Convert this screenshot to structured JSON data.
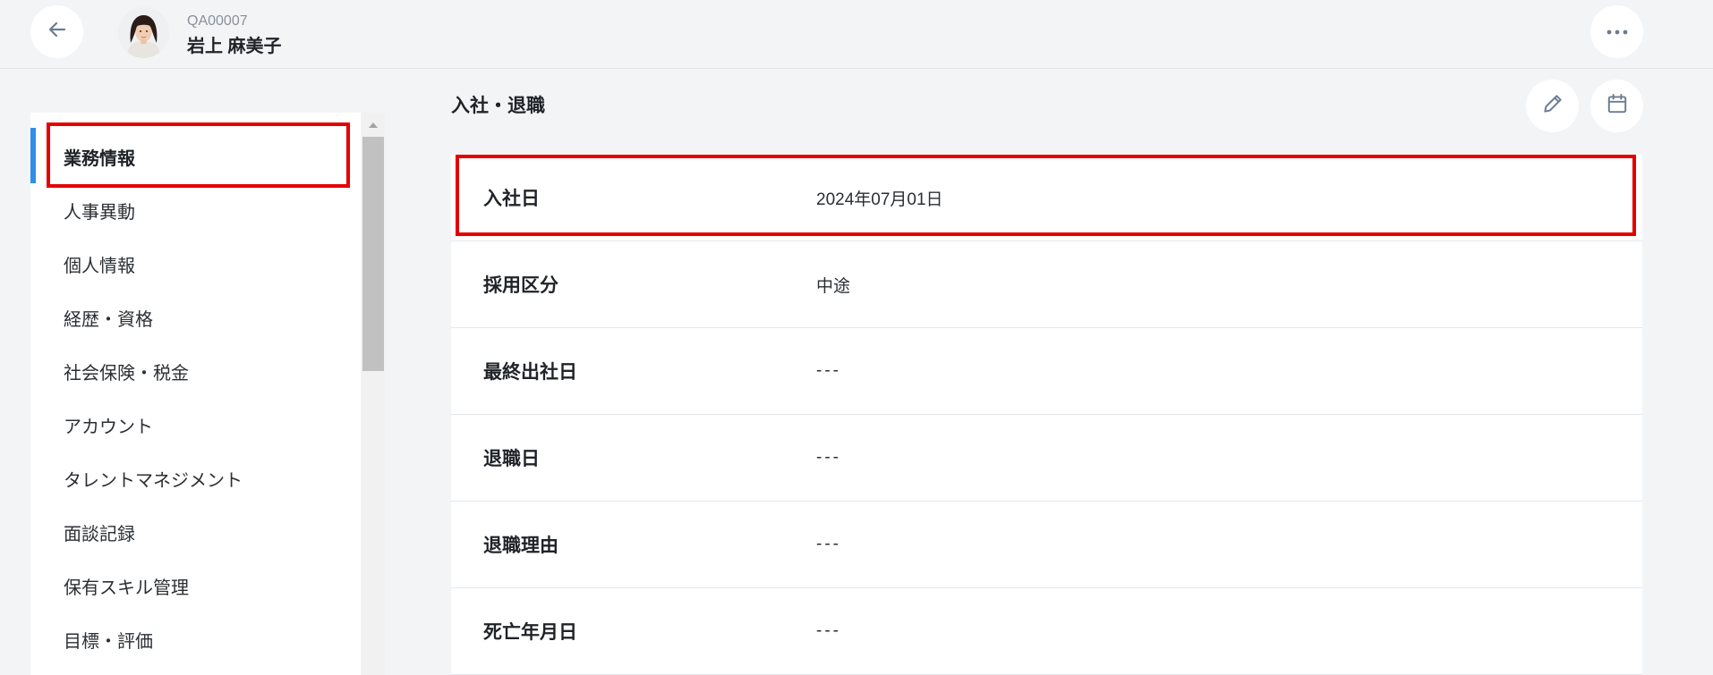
{
  "header": {
    "employee_id": "QA00007",
    "employee_name": "岩上 麻美子"
  },
  "sidebar": {
    "items": [
      {
        "label": "業務情報",
        "active": true
      },
      {
        "label": "人事異動"
      },
      {
        "label": "個人情報"
      },
      {
        "label": "経歴・資格"
      },
      {
        "label": "社会保険・税金"
      },
      {
        "label": "アカウント"
      },
      {
        "label": "タレントマネジメント"
      },
      {
        "label": "面談記録"
      },
      {
        "label": "保有スキル管理"
      },
      {
        "label": "目標・評価"
      }
    ]
  },
  "main": {
    "section_title": "入社・退職",
    "rows": [
      {
        "label": "入社日",
        "value": "2024年07月01日"
      },
      {
        "label": "採用区分",
        "value": "中途"
      },
      {
        "label": "最終出社日",
        "value": "---"
      },
      {
        "label": "退職日",
        "value": "---"
      },
      {
        "label": "退職理由",
        "value": "---"
      },
      {
        "label": "死亡年月日",
        "value": "---"
      }
    ]
  },
  "icons": {
    "back": "arrow-left-icon",
    "more": "more-horizontal-icon",
    "edit": "pencil-icon",
    "calendar": "calendar-icon",
    "scroll_up": "triangle-up-icon"
  },
  "colors": {
    "accent": "#2f8fe8",
    "highlight": "#e60000",
    "background": "#f3f4f6",
    "icon": "#6b7c93"
  }
}
